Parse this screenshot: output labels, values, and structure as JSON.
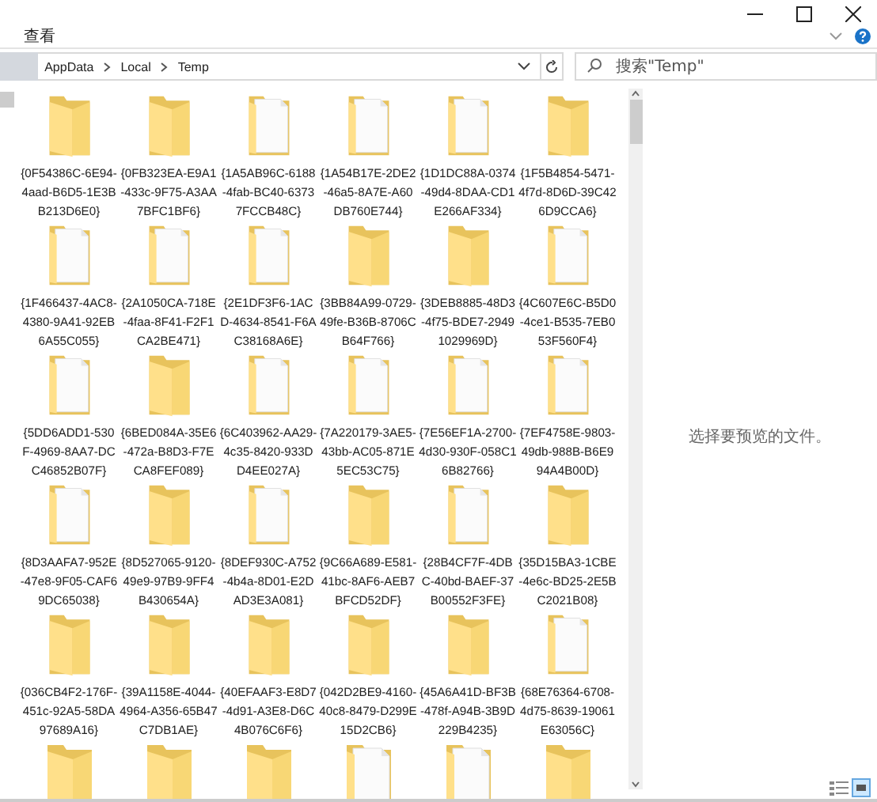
{
  "ribbon": {
    "tab": "查看"
  },
  "address": {
    "path": [
      {
        "label": "AppData"
      },
      {
        "label": "Local"
      },
      {
        "label": "Temp"
      }
    ]
  },
  "search": {
    "placeholder": "搜索\"Temp\""
  },
  "files": [
    {
      "name": "{0F54386C-6E94-4aad-B6D5-1E3BB213D6E0}",
      "kind": "plain"
    },
    {
      "name": "{0FB323EA-E9A1-433c-9F75-A3AA7BFC1BF6}",
      "kind": "plain"
    },
    {
      "name": "{1A5AB96C-6188-4fab-BC40-63737FCCB48C}",
      "kind": "docs"
    },
    {
      "name": "{1A54B17E-2DE2-46a5-8A7E-A60DB760E744}",
      "kind": "docs"
    },
    {
      "name": "{1D1DC88A-0374-49d4-8DAA-CD1E266AF334}",
      "kind": "docs"
    },
    {
      "name": "{1F5B4854-5471-4f7d-8D6D-39C426D9CCA6}",
      "kind": "plain"
    },
    {
      "name": "{1F466437-4AC8-4380-9A41-92EB6A55C055}",
      "kind": "docs"
    },
    {
      "name": "{2A1050CA-718E-4faa-8F41-F2F1CA2BE471}",
      "kind": "docs"
    },
    {
      "name": "{2E1DF3F6-1ACD-4634-8541-F6AC38168A6E}",
      "kind": "docs"
    },
    {
      "name": "{3BB84A99-0729-49fe-B36B-8706CB64F766}",
      "kind": "plain"
    },
    {
      "name": "{3DEB8885-48D3-4f75-BDE7-29491029969D}",
      "kind": "plain"
    },
    {
      "name": "{4C607E6C-B5D0-4ce1-B535-7EB053F560F4}",
      "kind": "docs"
    },
    {
      "name": "{5DD6ADD1-530F-4969-8AA7-DCC46852B07F}",
      "kind": "docs"
    },
    {
      "name": "{6BED084A-35E6-472a-B8D3-F7ECA8FEF089}",
      "kind": "plain"
    },
    {
      "name": "{6C403962-AA29-4c35-8420-933DD4EE027A}",
      "kind": "docs"
    },
    {
      "name": "{7A220179-3AE5-43bb-AC05-871E5EC53C75}",
      "kind": "docs"
    },
    {
      "name": "{7E56EF1A-2700-4d30-930F-058C16B82766}",
      "kind": "docs"
    },
    {
      "name": "{7EF4758E-9803-49db-988B-B6E994A4B00D}",
      "kind": "docs"
    },
    {
      "name": "{8D3AAFA7-952E-47e8-9F05-CAF69DC65038}",
      "kind": "docs"
    },
    {
      "name": "{8D527065-9120-49e9-97B9-9FF4B430654A}",
      "kind": "plain"
    },
    {
      "name": "{8DEF930C-A752-4b4a-8D01-E2DAD3E3A081}",
      "kind": "docs"
    },
    {
      "name": "{9C66A689-E581-41bc-8AF6-AEB7BFCD52DF}",
      "kind": "plain"
    },
    {
      "name": "{28B4CF7F-4DBC-40bd-BAEF-37B00552F3FE}",
      "kind": "docs"
    },
    {
      "name": "{35D15BA3-1CBE-4e6c-BD25-2E5BC2021B08}",
      "kind": "plain"
    },
    {
      "name": "{036CB4F2-176F-451c-92A5-58DA97689A16}",
      "kind": "plain"
    },
    {
      "name": "{39A1158E-4044-4964-A356-65B47C7DB1AE}",
      "kind": "plain"
    },
    {
      "name": "{40EFAAF3-E8D7-4d91-A3E8-D6C4B076C6F6}",
      "kind": "plain"
    },
    {
      "name": "{042D2BE9-4160-40c8-8479-D299E15D2CB6}",
      "kind": "plain"
    },
    {
      "name": "{45A6A41D-BF3B-478f-A94B-3B9D229B4235}",
      "kind": "plain"
    },
    {
      "name": "{68E76364-6708-4d75-8639-19061E63056C}",
      "kind": "docs"
    },
    {
      "kind": "plain"
    },
    {
      "kind": "plain"
    },
    {
      "kind": "plain"
    },
    {
      "kind": "docs"
    },
    {
      "kind": "docs"
    },
    {
      "kind": "plain"
    }
  ],
  "preview": {
    "message": "选择要预览的文件。"
  }
}
